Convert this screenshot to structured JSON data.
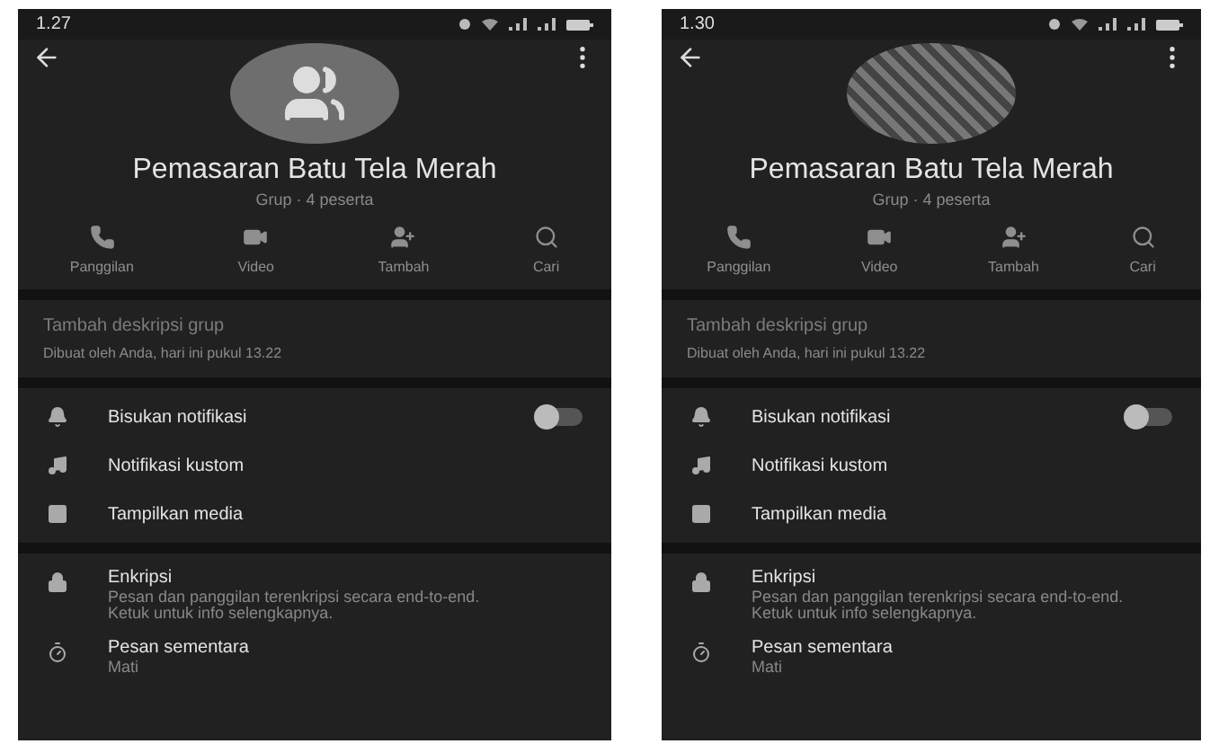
{
  "phones": [
    {
      "time": "1.27",
      "avatar": {
        "kind": "icon"
      },
      "title": "Pemasaran Batu Tela Merah",
      "subtitle": "Grup · 4 peserta",
      "actions": [
        "Panggilan",
        "Video",
        "Tambah",
        "Cari"
      ],
      "description": "Tambah deskripsi grup",
      "created": "Dibuat oleh Anda, hari ini pukul 13.22",
      "settings": [
        {
          "kind": "toggle",
          "label": "Bisukan notifikasi",
          "on": false
        },
        {
          "kind": "plain",
          "label": "Notifikasi kustom"
        },
        {
          "kind": "plain",
          "label": "Tampilkan media"
        }
      ],
      "privacy": [
        {
          "title": "Enkripsi",
          "detail": "Pesan dan panggilan terenkripsi secara end-to-end. Ketuk untuk info selengkapnya."
        },
        {
          "title": "Pesan sementara",
          "detail": "Mati"
        }
      ]
    },
    {
      "time": "1.30",
      "avatar": {
        "kind": "photo"
      },
      "title": "Pemasaran Batu Tela Merah",
      "subtitle": "Grup · 4 peserta",
      "actions": [
        "Panggilan",
        "Video",
        "Tambah",
        "Cari"
      ],
      "description": "Tambah deskripsi grup",
      "created": "Dibuat oleh Anda, hari ini pukul 13.22",
      "settings": [
        {
          "kind": "toggle",
          "label": "Bisukan notifikasi",
          "on": false
        },
        {
          "kind": "plain",
          "label": "Notifikasi kustom"
        },
        {
          "kind": "plain",
          "label": "Tampilkan media"
        }
      ],
      "privacy": [
        {
          "title": "Enkripsi",
          "detail": "Pesan dan panggilan terenkripsi secara end-to-end. Ketuk untuk info selengkapnya."
        },
        {
          "title": "Pesan sementara",
          "detail": "Mati"
        }
      ]
    }
  ]
}
